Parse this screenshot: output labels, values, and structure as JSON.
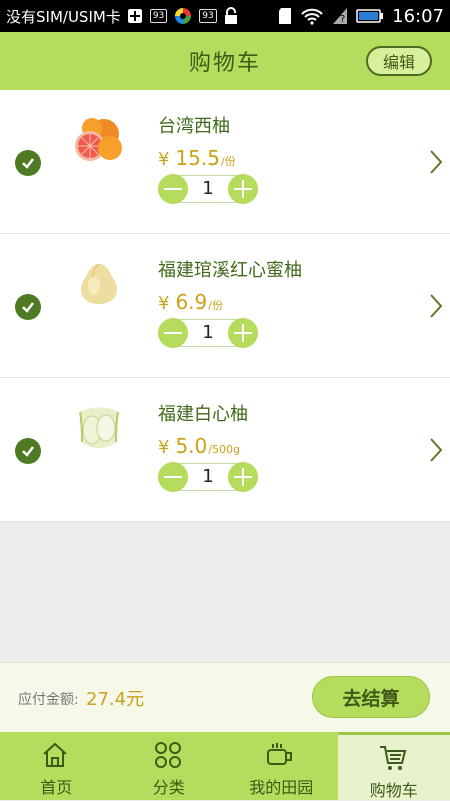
{
  "status_bar": {
    "carrier": "没有SIM/USIM卡",
    "badge1": "93",
    "badge2": "93",
    "time": "16:07",
    "icons": [
      "plus-box-icon",
      "colorful-app-icon",
      "lock-icon",
      "sd-card-icon",
      "wifi-icon",
      "no-signal-icon",
      "battery-icon"
    ]
  },
  "header": {
    "title": "购物车",
    "edit_label": "编辑"
  },
  "cart": {
    "items": [
      {
        "name": "台湾西柚",
        "currency": "¥",
        "price": "15.5",
        "unit": "/份",
        "quantity": "1",
        "checked": true
      },
      {
        "name": "福建琯溪红心蜜柚",
        "currency": "¥",
        "price": "6.9",
        "unit": "/份",
        "quantity": "1",
        "checked": true
      },
      {
        "name": "福建白心柚",
        "currency": "¥",
        "price": "5.0",
        "unit": "/500g",
        "quantity": "1",
        "checked": true
      }
    ]
  },
  "checkout": {
    "total_label": "应付金额:",
    "total_value": "27.4元",
    "button_label": "去结算"
  },
  "nav": {
    "items": [
      {
        "label": "首页",
        "icon": "home-icon",
        "active": false
      },
      {
        "label": "分类",
        "icon": "grid-icon",
        "active": false
      },
      {
        "label": "我的田园",
        "icon": "cup-icon",
        "active": false
      },
      {
        "label": "购物车",
        "icon": "cart-icon",
        "active": true
      }
    ]
  },
  "colors": {
    "accent": "#b5dc5d",
    "dark_green": "#3f5a17",
    "price": "#c9a21a",
    "check": "#4f7a24"
  }
}
